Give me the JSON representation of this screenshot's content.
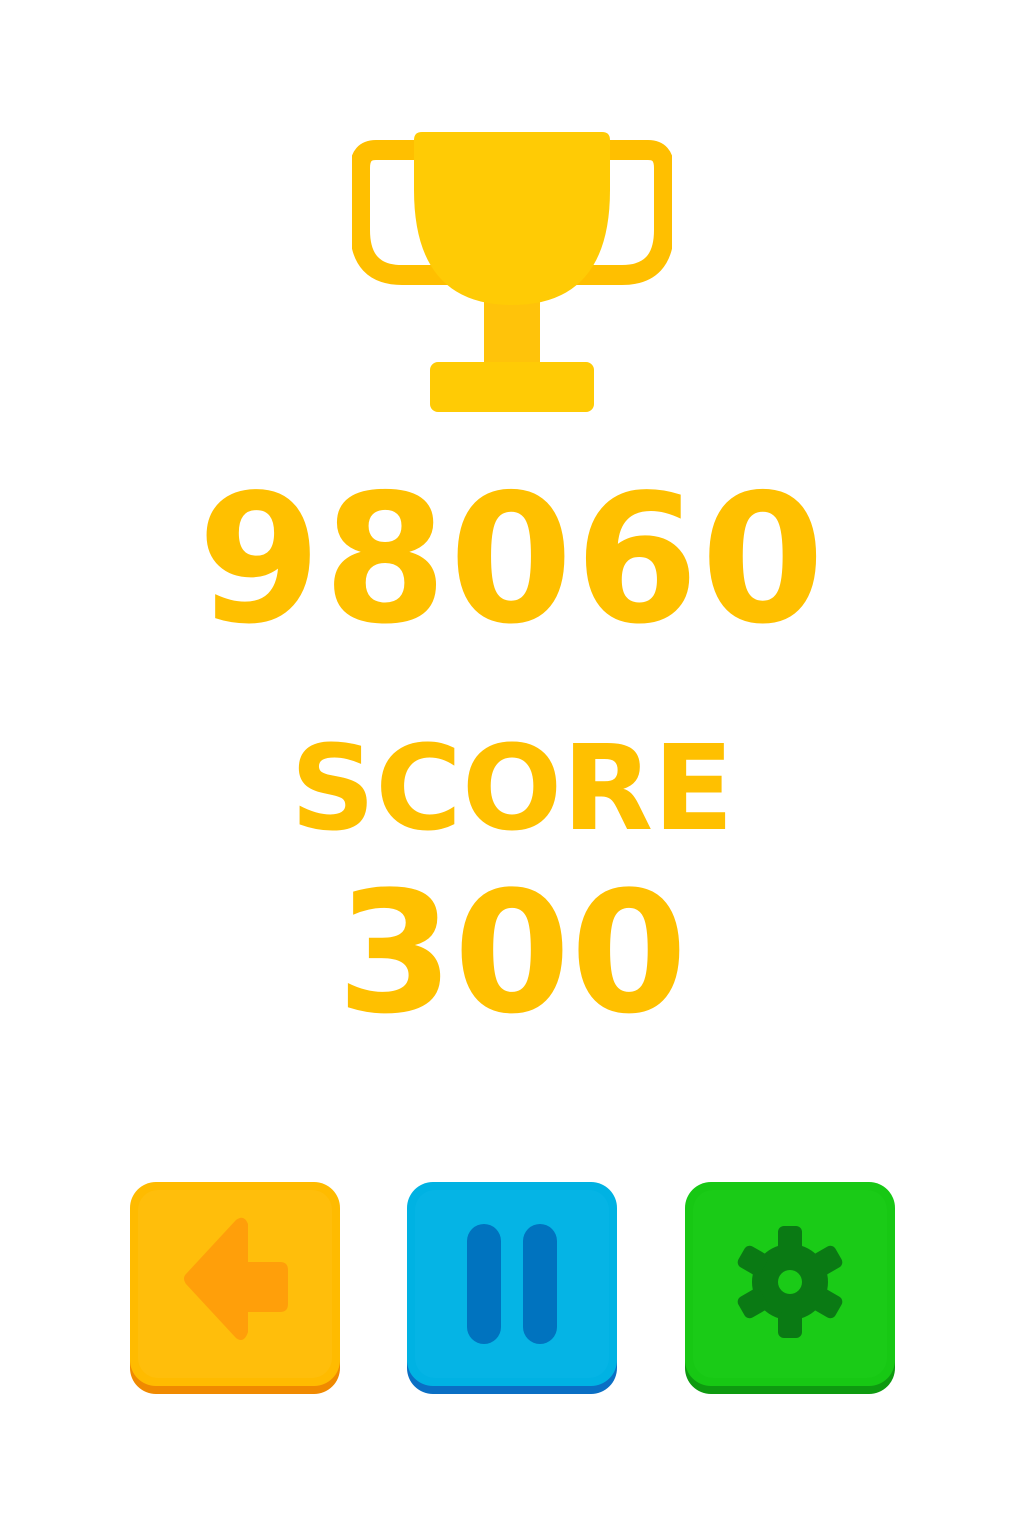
{
  "best_score": "98060",
  "score_label": "SCORE",
  "score": "300",
  "colors": {
    "score_text": "#FFC000",
    "trophy_main": "#FFCB05",
    "trophy_handle": "#FFBF00",
    "back_button": "#FFBB00",
    "back_icon": "#FF9F0A",
    "pause_button": "#00B2E3",
    "pause_icon": "#0073BF",
    "settings_button": "#17C814",
    "settings_icon": "#0A7A14"
  },
  "icons": {
    "trophy": "trophy-icon",
    "back": "arrow-left-icon",
    "pause": "pause-icon",
    "settings": "gear-icon"
  }
}
